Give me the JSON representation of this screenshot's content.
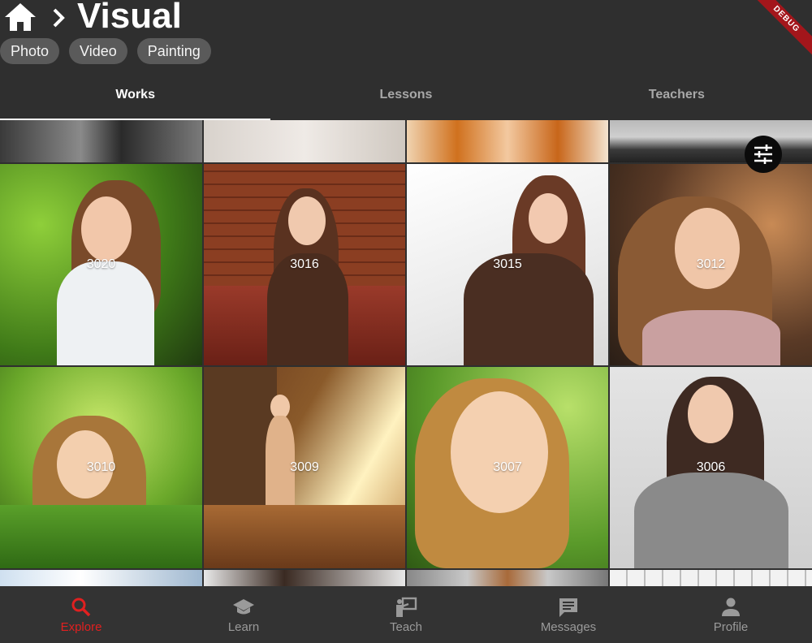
{
  "header": {
    "title": "Visual",
    "home_icon": "home-icon",
    "chevron_icon": "chevron-right-icon",
    "debug_banner": "DEBUG"
  },
  "chips": [
    {
      "label": "Photo"
    },
    {
      "label": "Video"
    },
    {
      "label": "Painting"
    }
  ],
  "tabs": [
    {
      "label": "Works",
      "active": true
    },
    {
      "label": "Lessons",
      "active": false
    },
    {
      "label": "Teachers",
      "active": false
    }
  ],
  "gallery": {
    "rows": [
      [
        {
          "id": "3020"
        },
        {
          "id": "3016"
        },
        {
          "id": "3015"
        },
        {
          "id": "3012"
        }
      ],
      [
        {
          "id": "3010"
        },
        {
          "id": "3009"
        },
        {
          "id": "3007"
        },
        {
          "id": "3006"
        }
      ]
    ],
    "filter_icon": "tune-icon"
  },
  "bottom_nav": [
    {
      "label": "Explore",
      "icon": "search-icon",
      "active": true
    },
    {
      "label": "Learn",
      "icon": "school-icon",
      "active": false
    },
    {
      "label": "Teach",
      "icon": "teacher-icon",
      "active": false
    },
    {
      "label": "Messages",
      "icon": "chat-icon",
      "active": false
    },
    {
      "label": "Profile",
      "icon": "person-icon",
      "active": false
    }
  ],
  "colors": {
    "background": "#2f2f2f",
    "accent": "#e02020",
    "chip": "#5a5a5a",
    "debug": "#a3161b"
  }
}
